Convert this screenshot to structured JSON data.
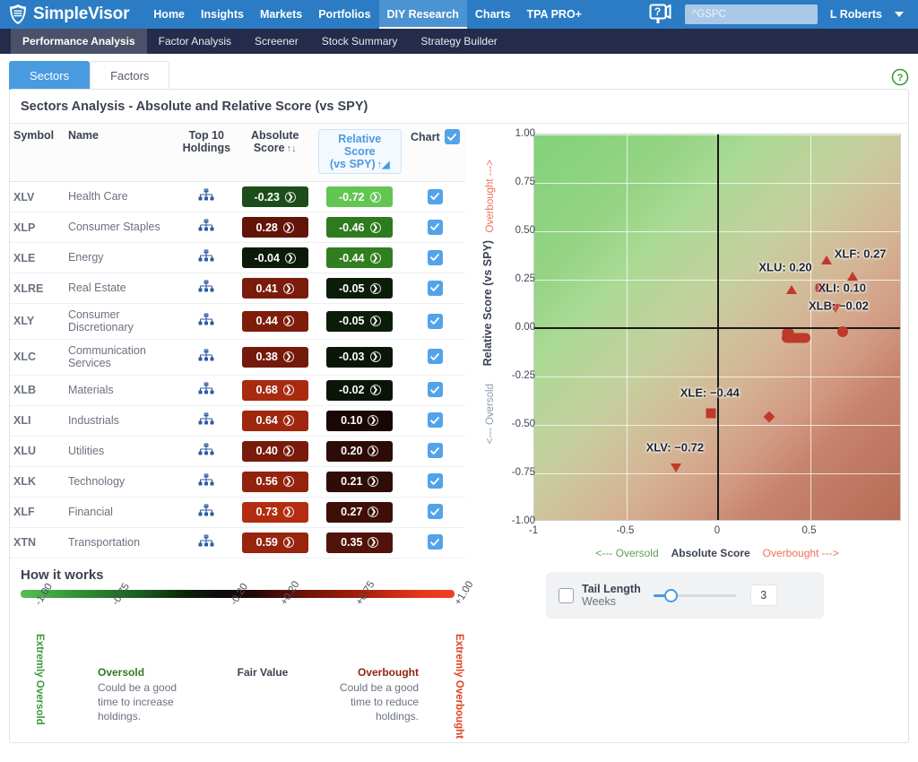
{
  "brand": {
    "name": "SimpleVisor",
    "logo_icon": "shield-logo-icon"
  },
  "topnav": {
    "items": [
      {
        "label": "Home",
        "active": false
      },
      {
        "label": "Insights",
        "active": false
      },
      {
        "label": "Markets",
        "active": false
      },
      {
        "label": "Portfolios",
        "active": false
      },
      {
        "label": "DIY Research",
        "active": true
      },
      {
        "label": "Charts",
        "active": false
      },
      {
        "label": "TPA PRO+",
        "active": false
      }
    ],
    "help_icon": "help-screen-icon",
    "ticker_value": "^GSPC",
    "user": "L Roberts",
    "caret_icon": "chevron-down-icon"
  },
  "subnav": {
    "items": [
      {
        "label": "Performance Analysis",
        "active": true
      },
      {
        "label": "Factor Analysis",
        "active": false
      },
      {
        "label": "Screener",
        "active": false
      },
      {
        "label": "Stock Summary",
        "active": false
      },
      {
        "label": "Strategy Builder",
        "active": false
      }
    ]
  },
  "tabs": [
    {
      "label": "Sectors",
      "active": true
    },
    {
      "label": "Factors",
      "active": false
    }
  ],
  "help_circle_icon": "question-circle-icon",
  "panel": {
    "title": "Sectors Analysis - Absolute and Relative Score (vs SPY)"
  },
  "table": {
    "headers": {
      "symbol": "Symbol",
      "name": "Name",
      "top10_l1": "Top 10",
      "top10_l2": "Holdings",
      "abs_l1": "Absolute",
      "abs_l2": "Score",
      "abs_sort_icon": "sort-updown-icon",
      "rel_l1": "Relative Score",
      "rel_l2": "(vs SPY)",
      "rel_sort_icon": "sort-asc-icon",
      "chart": "Chart"
    },
    "rows": [
      {
        "symbol": "XLV",
        "name": "Health Care",
        "abs": "-0.23",
        "rel": "-0.72",
        "abs_color": "#1d4d1a",
        "rel_color": "#63c552",
        "checked": true
      },
      {
        "symbol": "XLP",
        "name": "Consumer Staples",
        "abs": "0.28",
        "rel": "-0.46",
        "abs_color": "#631409",
        "rel_color": "#2e7a1f",
        "checked": true
      },
      {
        "symbol": "XLE",
        "name": "Energy",
        "abs": "-0.04",
        "rel": "-0.44",
        "abs_color": "#0c1a08",
        "rel_color": "#317e21",
        "checked": true
      },
      {
        "symbol": "XLRE",
        "name": "Real Estate",
        "abs": "0.41",
        "rel": "-0.05",
        "abs_color": "#7a1c0b",
        "rel_color": "#0b1d08",
        "checked": true
      },
      {
        "symbol": "XLY",
        "name": "Consumer Discretionary",
        "abs": "0.44",
        "rel": "-0.05",
        "abs_color": "#7f1d0b",
        "rel_color": "#0b1d08",
        "checked": true
      },
      {
        "symbol": "XLC",
        "name": "Communication Services",
        "abs": "0.38",
        "rel": "-0.03",
        "abs_color": "#731a0a",
        "rel_color": "#0a1708",
        "checked": true
      },
      {
        "symbol": "XLB",
        "name": "Materials",
        "abs": "0.68",
        "rel": "-0.02",
        "abs_color": "#a82a10",
        "rel_color": "#0a1407",
        "checked": true
      },
      {
        "symbol": "XLI",
        "name": "Industrials",
        "abs": "0.64",
        "rel": "0.10",
        "abs_color": "#9f270f",
        "rel_color": "#180705",
        "checked": true
      },
      {
        "symbol": "XLU",
        "name": "Utilities",
        "abs": "0.40",
        "rel": "0.20",
        "abs_color": "#781b0b",
        "rel_color": "#2d0b06",
        "checked": true
      },
      {
        "symbol": "XLK",
        "name": "Technology",
        "abs": "0.56",
        "rel": "0.21",
        "abs_color": "#93230d",
        "rel_color": "#300c06",
        "checked": true
      },
      {
        "symbol": "XLF",
        "name": "Financial",
        "abs": "0.73",
        "rel": "0.27",
        "abs_color": "#b32d11",
        "rel_color": "#3d0f07",
        "checked": true
      },
      {
        "symbol": "XTN",
        "name": "Transportation",
        "abs": "0.59",
        "rel": "0.35",
        "abs_color": "#98240e",
        "rel_color": "#51140a",
        "checked": true
      }
    ],
    "holdings_icon": "org-chart-icon",
    "badge_arrow_icon": "chevron-right-circle-icon",
    "check_icon": "check-icon"
  },
  "how_it_works": {
    "title": "How it works",
    "ticks": [
      "-1.00",
      "-0.75",
      "-0.20",
      "+0.20",
      "+0.75",
      "+1.00"
    ],
    "left_vertical": "Extremly Oversold",
    "right_vertical": "Extremly Overbought",
    "blocks": [
      {
        "head": "Oversold",
        "body": "Could be a good time to increase holdings.",
        "color": "#2e7a1f"
      },
      {
        "head": "Fair Value",
        "body": "",
        "color": "#3b4252"
      },
      {
        "head": "Overbought",
        "body": "Could be a good time to reduce holdings.",
        "color": "#8f2410"
      }
    ],
    "gradient_left": "#54c054",
    "gradient_mid": "#0b0b0b",
    "gradient_right": "#f04020"
  },
  "tail_control": {
    "label": "Tail Length",
    "sub_label": "Weeks",
    "value": "3",
    "checked": false,
    "slider_min": 0,
    "slider_max": 24
  },
  "chart_data": {
    "type": "scatter",
    "title": "",
    "xlabel": "Absolute Score",
    "ylabel": "Relative Score (vs SPY)",
    "xlim": [
      -1,
      1
    ],
    "ylim": [
      -1,
      1
    ],
    "xticks": [
      "-1",
      "-0.5",
      "0",
      "0.5"
    ],
    "xtick_values": [
      -1,
      -0.5,
      0,
      0.5
    ],
    "yticks": [
      "1.00",
      "0.75",
      "0.50",
      "0.25",
      "0.00",
      "-0.25",
      "-0.50",
      "-0.75",
      "-1.00"
    ],
    "ytick_values": [
      1.0,
      0.75,
      0.5,
      0.25,
      0.0,
      -0.25,
      -0.5,
      -0.75,
      -1.0
    ],
    "grid": true,
    "legend": "none",
    "annotations": {
      "y_top": "Overbought --->",
      "y_bottom": "<--- Oversold",
      "x_left": "<--- Oversold",
      "x_right": "Overbought --->"
    },
    "marker_color": "#c0392b",
    "points": [
      {
        "symbol": "XLV",
        "x": -0.23,
        "y": -0.72,
        "marker": "triangle-down",
        "label": "XLV: −0.72",
        "labeled": true
      },
      {
        "symbol": "XLE",
        "x": -0.04,
        "y": -0.44,
        "marker": "square",
        "label": "XLE: −0.44",
        "labeled": true
      },
      {
        "symbol": "XLP",
        "x": 0.28,
        "y": -0.46,
        "marker": "diamond",
        "label": "",
        "labeled": false
      },
      {
        "symbol": "XLRE",
        "x": 0.41,
        "y": -0.05,
        "marker": "blob",
        "label": "",
        "labeled": false
      },
      {
        "symbol": "XLY",
        "x": 0.44,
        "y": -0.05,
        "marker": "blob",
        "label": "",
        "labeled": false
      },
      {
        "symbol": "XLC",
        "x": 0.38,
        "y": -0.03,
        "marker": "blob2",
        "label": "",
        "labeled": false
      },
      {
        "symbol": "XLB",
        "x": 0.68,
        "y": -0.02,
        "marker": "circle",
        "label": "XLB: −0.02",
        "labeled": true
      },
      {
        "symbol": "XLI",
        "x": 0.64,
        "y": 0.1,
        "marker": "triangle-down",
        "label": "XLI: 0.10",
        "labeled": true
      },
      {
        "symbol": "XLU",
        "x": 0.4,
        "y": 0.2,
        "marker": "triangle-up",
        "label": "XLU: 0.20",
        "labeled": true
      },
      {
        "symbol": "XLK",
        "x": 0.56,
        "y": 0.21,
        "marker": "blob2",
        "label": "",
        "labeled": false
      },
      {
        "symbol": "XLF",
        "x": 0.73,
        "y": 0.27,
        "marker": "triangle-up",
        "label": "XLF: 0.27",
        "labeled": true
      },
      {
        "symbol": "XTN",
        "x": 0.59,
        "y": 0.35,
        "marker": "triangle-up",
        "label": "",
        "labeled": false
      }
    ]
  }
}
